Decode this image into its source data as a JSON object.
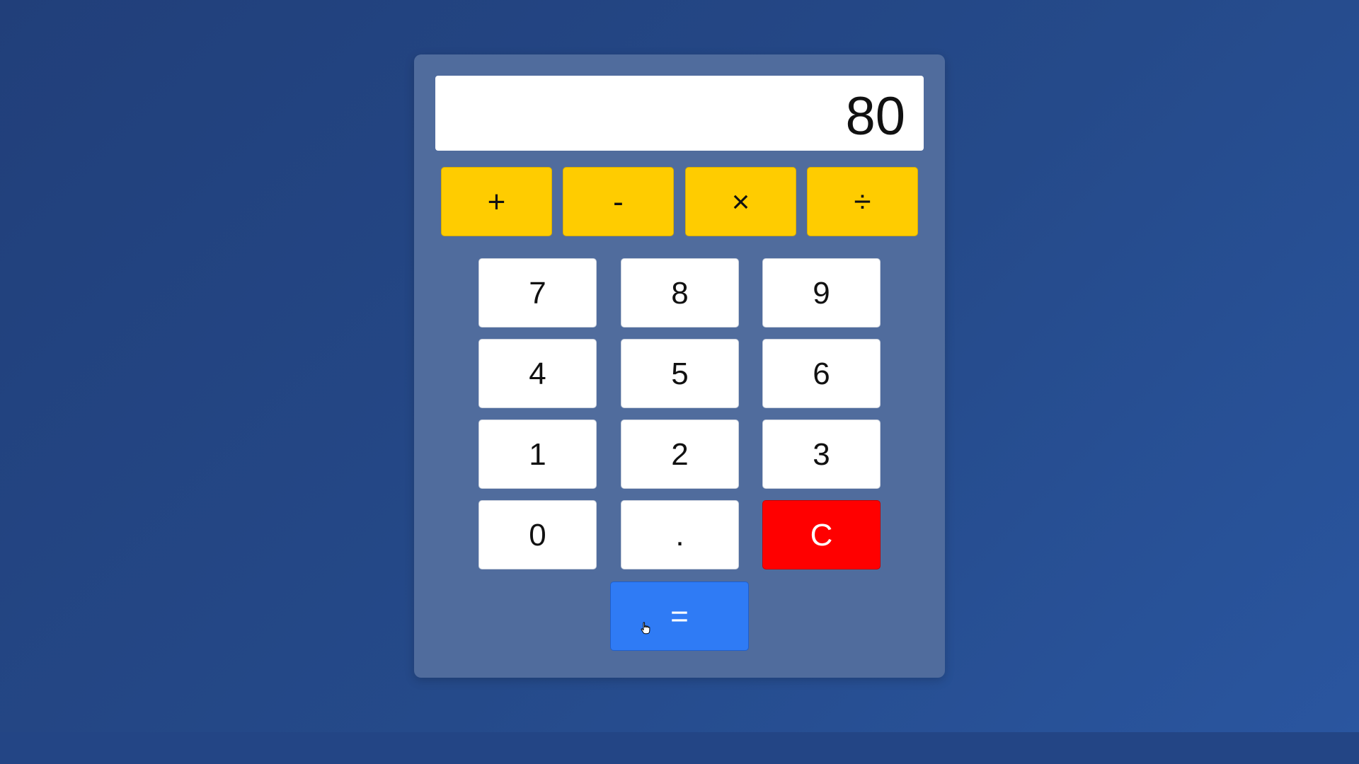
{
  "display": {
    "value": "80"
  },
  "operators": [
    {
      "label": "+"
    },
    {
      "label": "-"
    },
    {
      "label": "×"
    },
    {
      "label": "÷"
    }
  ],
  "keypad": {
    "rows": [
      [
        "7",
        "8",
        "9"
      ],
      [
        "4",
        "5",
        "6"
      ],
      [
        "1",
        "2",
        "3"
      ],
      [
        "0",
        ".",
        "C"
      ]
    ]
  },
  "equals": {
    "label": "="
  },
  "colors": {
    "background": "#234585",
    "panel": "#506c9d",
    "operator": "#ffcc00",
    "number": "#ffffff",
    "clear": "#ff0000",
    "equals": "#2f7bf5"
  },
  "icons": {
    "cursor": "hand-pointer-icon"
  }
}
